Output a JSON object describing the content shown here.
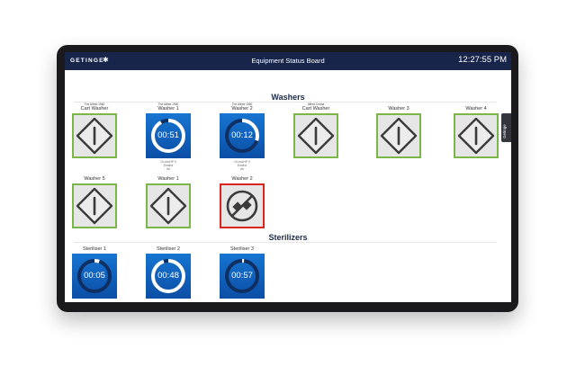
{
  "header": {
    "brand": "GETINGE",
    "title": "Equipment Status Board",
    "clock": "12:27:55 PM",
    "side_tab": "Getinge"
  },
  "sections": {
    "washers": "Washers",
    "sterilizers": "Sterilizers"
  },
  "washers_row1": [
    {
      "mini": "The Alfred 1960",
      "label": "Cart Washer",
      "state": "ready",
      "icon": "power-diamond-icon"
    },
    {
      "mini": "The Alfred 1960",
      "label": "Washer 1",
      "state": "running",
      "time": "00:51",
      "progress": 0.92,
      "sub1": "Gr-ecoHP II",
      "sub2": "Emdrol",
      "sub3": "##"
    },
    {
      "mini": "The Alfred 1960",
      "label": "Washer 2",
      "state": "running",
      "time": "00:12",
      "progress": 0.3,
      "sub1": "Gr-ecoHP II",
      "sub2": "Emdrol",
      "sub3": "##"
    },
    {
      "mini": "Alfred Cedna",
      "label": "Cart Washer",
      "state": "ready",
      "icon": "power-diamond-icon"
    },
    {
      "mini": "",
      "label": "Washer 3",
      "state": "ready",
      "icon": "power-diamond-icon"
    },
    {
      "mini": "",
      "label": "Washer 4",
      "state": "ready",
      "icon": "power-diamond-icon"
    }
  ],
  "washers_row2": [
    {
      "label": "Washer 5",
      "state": "ready",
      "icon": "power-diamond-icon"
    },
    {
      "label": "Washer 1",
      "state": "ready",
      "icon": "power-diamond-icon"
    },
    {
      "label": "Washer 2",
      "state": "fault",
      "icon": "disconnected-plug-icon"
    }
  ],
  "sterilizers": [
    {
      "label": "Steriliser 1",
      "state": "running",
      "time": "00:05",
      "progress": 0.05
    },
    {
      "label": "Steriliser 2",
      "state": "running",
      "time": "00:48",
      "progress": 0.95
    },
    {
      "label": "Steriliser 3",
      "state": "running",
      "time": "00:57",
      "progress": 0.02
    }
  ],
  "colors": {
    "header_bg": "#17254a",
    "ready_border": "#7ab648",
    "fault_border": "#d9261c",
    "running_bg": "#1675d1"
  }
}
